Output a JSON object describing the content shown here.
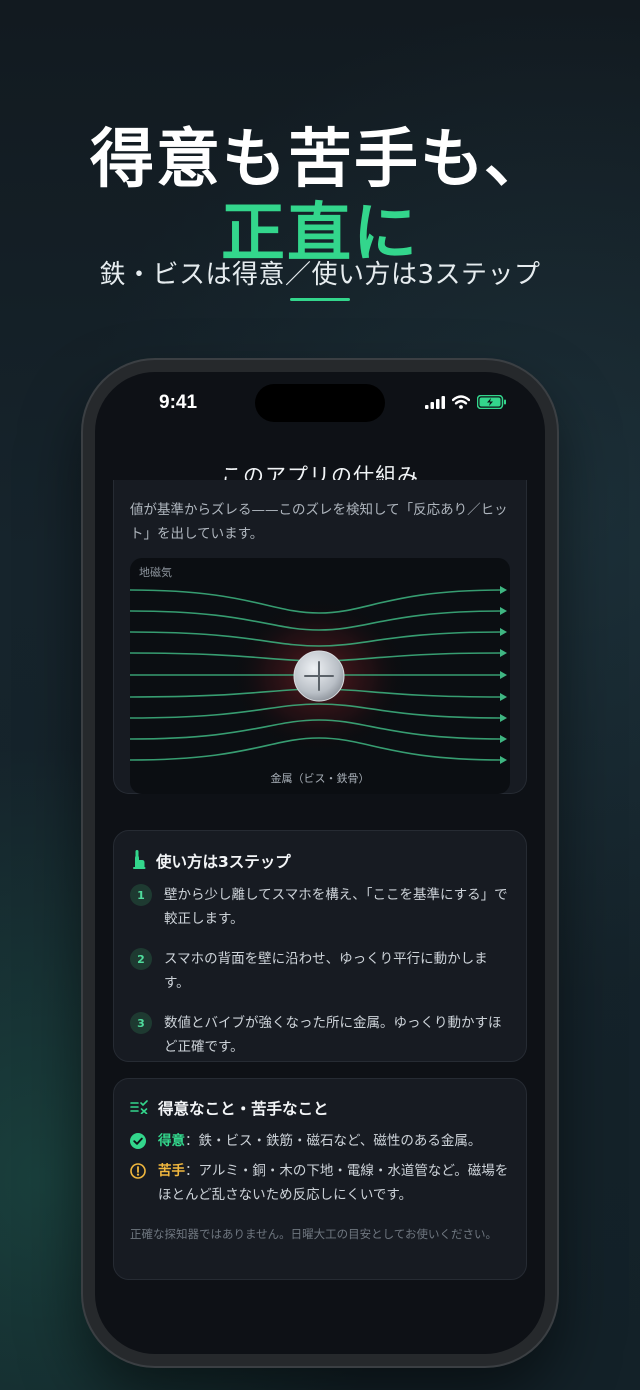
{
  "hero": {
    "line1": "得意も苦手も、",
    "line2": "正直に",
    "subtitle": "鉄・ビスは得意／使い方は3ステップ",
    "accent_color": "#33d68c"
  },
  "status_bar": {
    "time": "9:41"
  },
  "nav": {
    "title": "このアプリの仕組み"
  },
  "intro": {
    "text": "値が基準からズレる——このズレを検知して「反応あり／ヒット」を出しています。"
  },
  "diagram": {
    "label_top": "地磁気",
    "label_bottom": "金属（ビス・鉄骨）",
    "icon": "plus-icon"
  },
  "steps": {
    "title": "使い方は3ステップ",
    "icon": "finger-tap-icon",
    "items": [
      {
        "num": "1",
        "text": "壁から少し離してスマホを構え、「ここを基準にする」で較正します。"
      },
      {
        "num": "2",
        "text": "スマホの背面を壁に沿わせ、ゆっくり平行に動かします。"
      },
      {
        "num": "3",
        "text": "数値とバイブが強くなった所に金属。ゆっくり動かすほど正確です。"
      }
    ]
  },
  "good_bad": {
    "title": "得意なこと・苦手なこと",
    "icon": "checklist-icon",
    "good_label": "得意",
    "good_text": "：鉄・ビス・鉄筋・磁石など、磁性のある金属。",
    "bad_label": "苦手",
    "bad_text": "：アルミ・銅・木の下地・電線・水道管など。磁場をほとんど乱さないため反応しにくいです。",
    "good_color": "#33d68c",
    "bad_color": "#f0b73e"
  },
  "disclaimer": "正確な探知器ではありません。日曜大工の目安としてお使いください。"
}
